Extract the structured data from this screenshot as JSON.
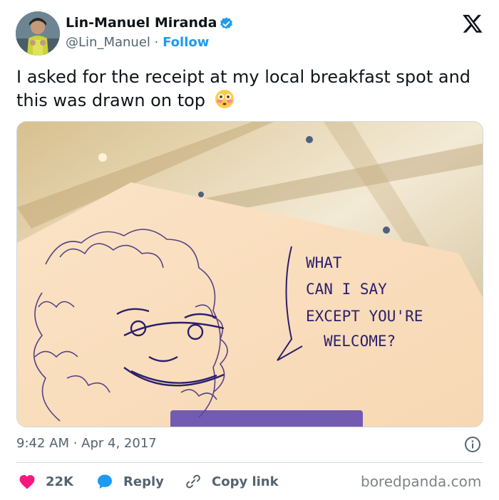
{
  "author": {
    "name": "Lin-Manuel Miranda",
    "handle": "@Lin_Manuel",
    "separator": "·",
    "follow_label": "Follow",
    "verified_icon": "verified-badge-icon",
    "brand_icon": "x-logo-icon"
  },
  "tweet": {
    "text": "I asked for the receipt at my local breakfast spot and this was drawn on top",
    "emoji_icon": "flushed-face-emoji",
    "image": {
      "speech_bubble_lines": [
        "WHAT",
        "CAN I SAY",
        "EXCEPT YOU'RE",
        "WELCOME?"
      ]
    },
    "timestamp": "9:42 AM · Apr 4, 2017",
    "info_icon": "info-icon"
  },
  "actions": {
    "like_count": "22K",
    "reply_label": "Reply",
    "copy_link_label": "Copy link"
  },
  "watermark": "boredpanda.com",
  "colors": {
    "accent": "#1d9bf0",
    "like": "#f91880",
    "secondary_text": "#536471"
  }
}
